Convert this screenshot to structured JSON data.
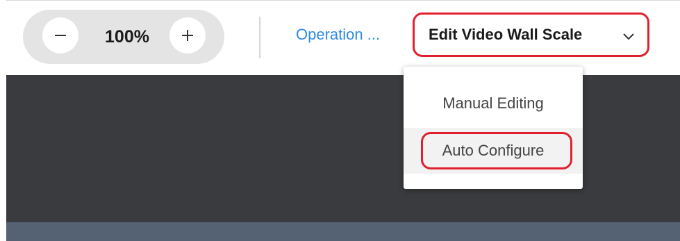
{
  "zoom": {
    "value": "100%",
    "decrease_icon": "minus-icon",
    "increase_icon": "plus-icon"
  },
  "toolbar": {
    "operation_link": "Operation ...",
    "scale_select_label": "Edit Video Wall Scale",
    "scale_select_icon": "chevron-down-icon"
  },
  "dropdown": {
    "items": [
      {
        "label": "Manual Editing"
      },
      {
        "label": "Auto Configure"
      }
    ]
  },
  "colors": {
    "highlight": "#e0202e",
    "link": "#2f8ae0",
    "canvas_dark": "#3a3b3f",
    "canvas_bottom": "#556273"
  }
}
